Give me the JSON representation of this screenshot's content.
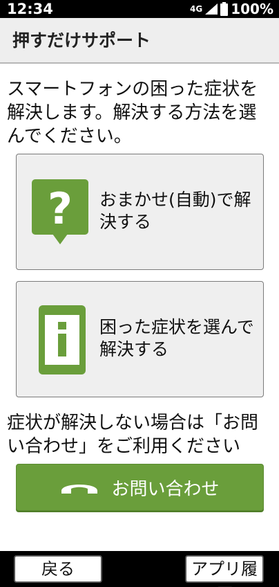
{
  "status_bar": {
    "time": "12:34",
    "network": "4G",
    "battery": "100%"
  },
  "header": {
    "title": "押すだけサポート"
  },
  "intro": "スマートフォンの困った症状を解決します。解決する方法を選んでください。",
  "options": [
    {
      "label": "おまかせ(自動)で解決する",
      "icon": "question-bubble-icon"
    },
    {
      "label": "困った症状を選んで解決する",
      "icon": "info-phone-icon"
    }
  ],
  "note": "症状が解決しない場合は「お問い合わせ」をご利用ください",
  "contact_button": {
    "label": "お問い合わせ",
    "icon": "phone-handset-icon"
  },
  "nav": {
    "back_label": "戻る",
    "history_label": "アプリ履歴"
  },
  "colors": {
    "accent_green": "#6a9e3b",
    "card_background": "#efefef",
    "header_background": "#eeeeee"
  }
}
